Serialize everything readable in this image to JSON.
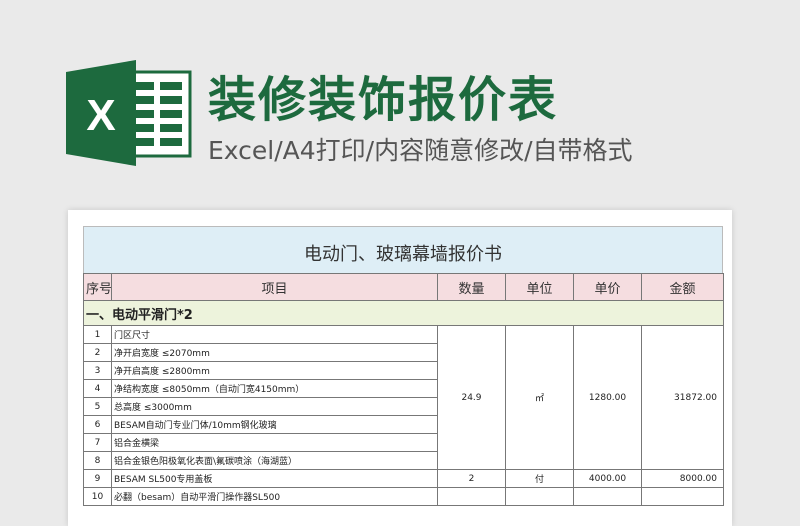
{
  "header": {
    "title": "装修装饰报价表",
    "subtitle": "Excel/A4打印/内容随意修改/自带格式",
    "logo_letter": "X",
    "logo_color": "#1d6a3e"
  },
  "sheet": {
    "title": "电动门、玻璃幕墙报价书",
    "columns": [
      "序号",
      "项目",
      "数量",
      "单位",
      "单价",
      "金额"
    ],
    "section": "一、电动平滑门*2",
    "group1": {
      "quantity": "24.9",
      "unit": "㎡",
      "price": "1280.00",
      "amount": "31872.00"
    },
    "rows": [
      {
        "no": "1",
        "item": "门区尺寸"
      },
      {
        "no": "2",
        "item": "净开启宽度  ≤2070mm"
      },
      {
        "no": "3",
        "item": "净开启高度  ≤2800mm"
      },
      {
        "no": "4",
        "item": "净结构宽度  ≤8050mm（自动门宽4150mm）"
      },
      {
        "no": "5",
        "item": "总高度        ≤3000mm"
      },
      {
        "no": "6",
        "item": "BESAM自动门专业门体/10mm钢化玻璃"
      },
      {
        "no": "7",
        "item": "铝合金横梁"
      },
      {
        "no": "8",
        "item": "铝合金银色阳极氧化表面\\氟碳喷涂（海湖蓝）"
      },
      {
        "no": "9",
        "item": "BESAM SL500专用盖板",
        "quantity": "2",
        "unit": "付",
        "price": "4000.00",
        "amount": "8000.00"
      },
      {
        "no": "10",
        "item": "必翻（besam）自动平滑门操作器SL500"
      }
    ]
  }
}
